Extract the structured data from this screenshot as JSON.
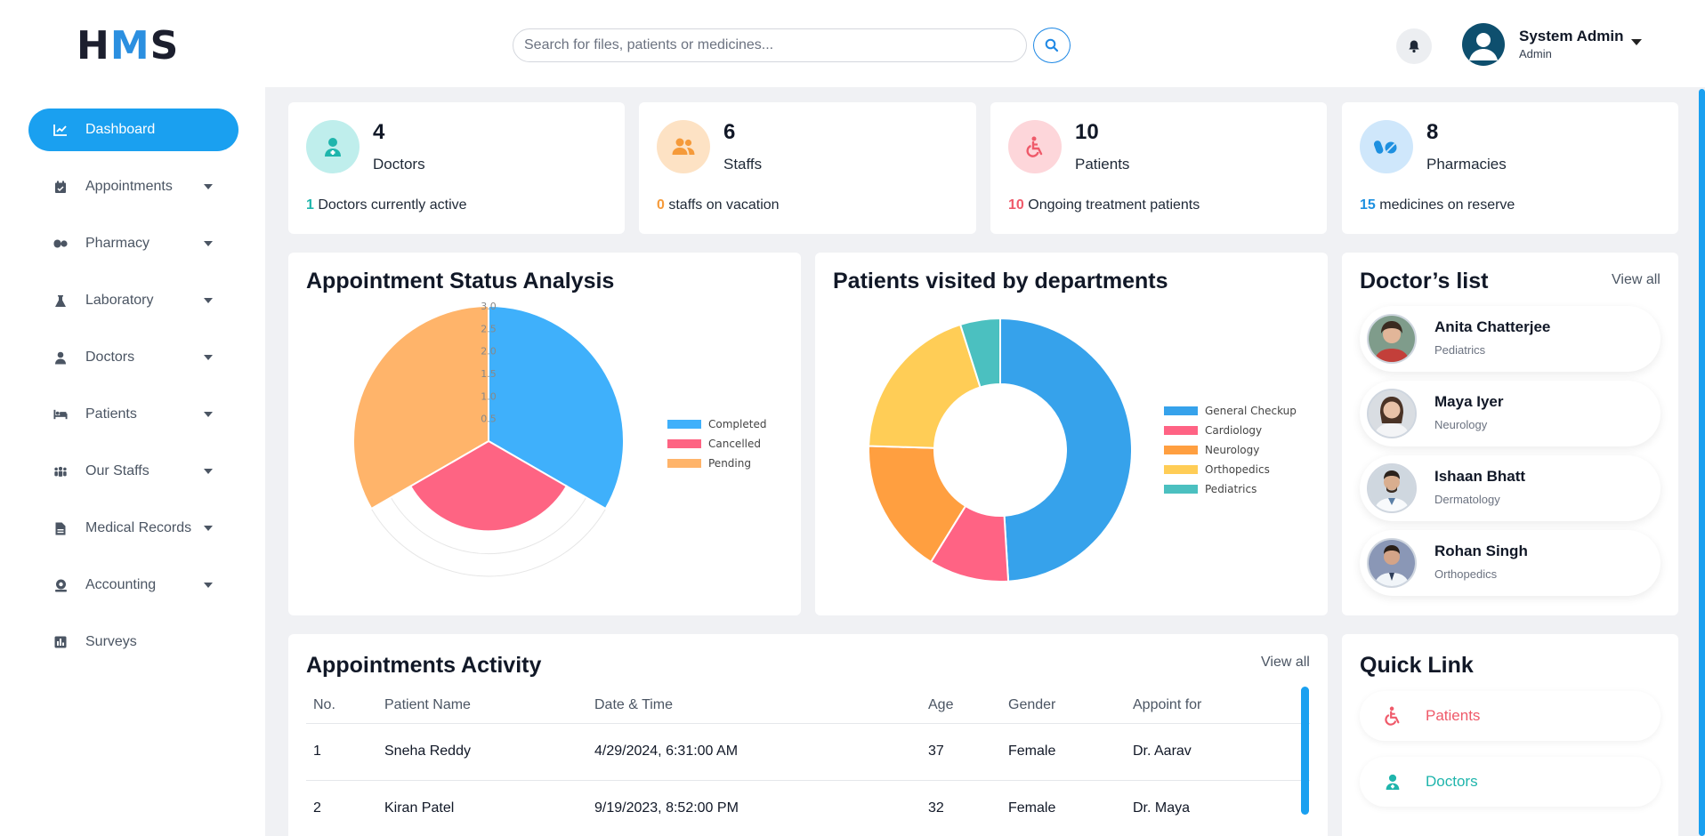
{
  "app": {
    "logo_h": "H",
    "logo_m": "M",
    "logo_s": "S"
  },
  "search": {
    "placeholder": "Search for files, patients or medicines..."
  },
  "user": {
    "name": "System Admin",
    "role": "Admin"
  },
  "sidebar": {
    "items": [
      {
        "label": "Dashboard",
        "icon": "chart-line-icon",
        "active": true
      },
      {
        "label": "Appointments",
        "icon": "calendar-check-icon"
      },
      {
        "label": "Pharmacy",
        "icon": "pills-icon"
      },
      {
        "label": "Laboratory",
        "icon": "flask-icon"
      },
      {
        "label": "Doctors",
        "icon": "user-doctor-icon"
      },
      {
        "label": "Patients",
        "icon": "bed-icon"
      },
      {
        "label": "Our Staffs",
        "icon": "people-group-icon"
      },
      {
        "label": "Medical Records",
        "icon": "file-medical-icon"
      },
      {
        "label": "Accounting",
        "icon": "money-check-icon"
      },
      {
        "label": "Surveys",
        "icon": "square-poll-icon"
      }
    ]
  },
  "stats": [
    {
      "value": "4",
      "label": "Doctors",
      "note_num": "1",
      "note_text": " Doctors currently active",
      "color": "#1fb5ac",
      "bg": "#bfeeec"
    },
    {
      "value": "6",
      "label": "Staffs",
      "note_num": "0",
      "note_text": " staffs on vacation",
      "color": "#f59a3a",
      "bg": "#fde2c4"
    },
    {
      "value": "10",
      "label": "Patients",
      "note_num": "10",
      "note_text": " Ongoing treatment patients",
      "color": "#ef5a6a",
      "bg": "#fdd6da"
    },
    {
      "value": "8",
      "label": "Pharmacies",
      "note_num": "15",
      "note_text": " medicines on reserve",
      "color": "#1e90e0",
      "bg": "#cfe7fb"
    }
  ],
  "appointment_chart": {
    "title": "Appointment Status Analysis",
    "ticks": [
      "0.5",
      "1.0",
      "1.5",
      "2.0",
      "2.5",
      "3.0"
    ]
  },
  "department_chart": {
    "title": "Patients visited by departments"
  },
  "chart_data": [
    {
      "type": "polarArea",
      "categories": [
        "Completed",
        "Cancelled",
        "Pending"
      ],
      "values": [
        3,
        2,
        3
      ],
      "colors": [
        "#3fb0fb",
        "#fe6483",
        "#ffb46a"
      ],
      "rlim": [
        0,
        3
      ],
      "ticks": [
        0.5,
        1.0,
        1.5,
        2.0,
        2.5,
        3.0
      ],
      "legend": "right"
    },
    {
      "type": "doughnut",
      "categories": [
        "General Checkup",
        "Cardiology",
        "Neurology",
        "Orthopedics",
        "Pediatrics"
      ],
      "values": [
        5,
        1,
        1.7,
        2,
        0.5
      ],
      "colors": [
        "#36a2eb",
        "#ff6384",
        "#ff9f40",
        "#ffcd56",
        "#4bc0c0"
      ],
      "legend": "right"
    }
  ],
  "doctors_list": {
    "title": "Doctor’s list",
    "view_all": "View all",
    "items": [
      {
        "name": "Anita Chatterjee",
        "dept": "Pediatrics"
      },
      {
        "name": "Maya Iyer",
        "dept": "Neurology"
      },
      {
        "name": "Ishaan Bhatt",
        "dept": "Dermatology"
      },
      {
        "name": "Rohan Singh",
        "dept": "Orthopedics"
      }
    ]
  },
  "activity": {
    "title": "Appointments Activity",
    "view_all": "View all",
    "columns": [
      "No.",
      "Patient Name",
      "Date & Time",
      "Age",
      "Gender",
      "Appoint for"
    ],
    "rows": [
      {
        "no": "1",
        "name": "Sneha Reddy",
        "datetime": "4/29/2024, 6:31:00 AM",
        "age": "37",
        "gender": "Female",
        "doctor": "Dr. Aarav"
      },
      {
        "no": "2",
        "name": "Kiran Patel",
        "datetime": "9/19/2023, 8:52:00 PM",
        "age": "32",
        "gender": "Female",
        "doctor": "Dr. Maya"
      }
    ]
  },
  "quick_links": {
    "title": "Quick Link",
    "items": [
      {
        "label": "Patients",
        "icon": "wheelchair-icon",
        "color": "#ef5a6a"
      },
      {
        "label": "Doctors",
        "icon": "user-doctor-icon",
        "color": "#1fb5ac"
      }
    ]
  }
}
